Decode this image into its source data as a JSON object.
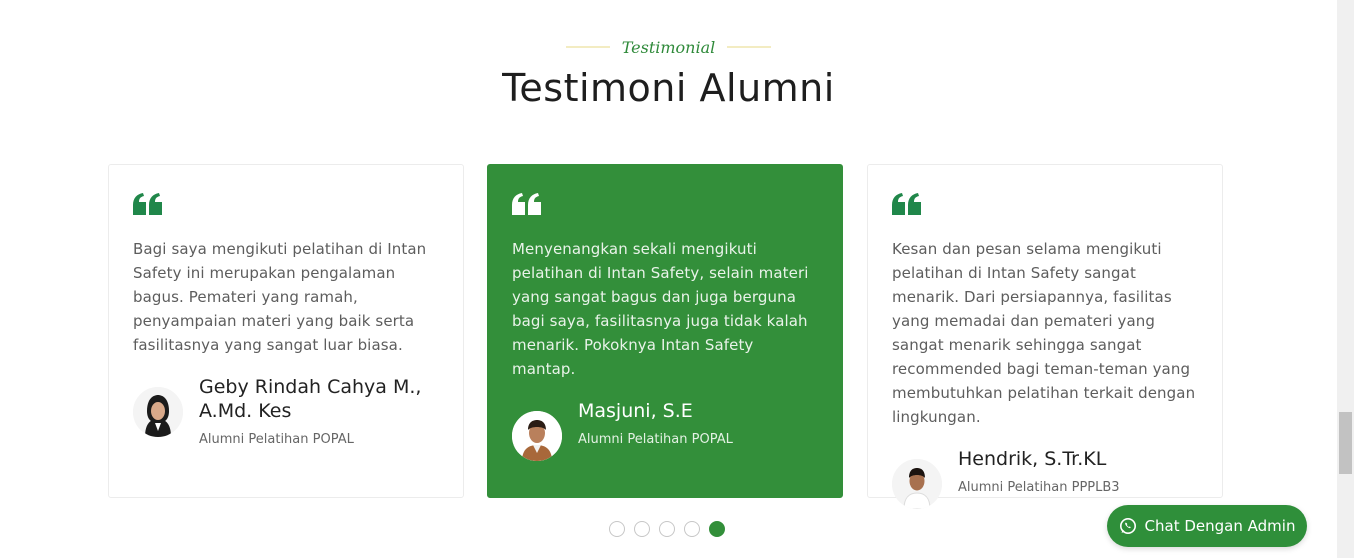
{
  "section": {
    "eyebrow": "Testimonial",
    "title": "Testimoni Alumni"
  },
  "testimonials": [
    {
      "text": "Bagi saya mengikuti pelatihan di Intan Safety ini merupakan pengalaman bagus. Pemateri yang ramah, penyampaian materi yang baik serta fasilitasnya yang sangat luar biasa.",
      "name": "Geby Rindah Cahya M., A.Md. Kes",
      "role": "Alumni Pelatihan POPAL"
    },
    {
      "text": "Menyenangkan sekali mengikuti pelatihan di Intan Safety, selain materi yang sangat bagus dan juga berguna bagi saya, fasilitasnya juga tidak kalah menarik. Pokoknya Intan Safety mantap.",
      "name": "Masjuni, S.E",
      "role": "Alumni Pelatihan POPAL"
    },
    {
      "text": "Kesan dan pesan selama mengikuti pelatihan di Intan Safety sangat menarik. Dari persiapannya, fasilitas yang memadai dan pemateri yang sangat menarik sehingga sangat recommended bagi teman-teman yang membutuhkan pelatihan terkait dengan lingkungan.",
      "name": "Hendrik, S.Tr.KL",
      "role": "Alumni Pelatihan PPPLB3"
    }
  ],
  "carousel": {
    "page_count": 5,
    "active_page": 5
  },
  "chat": {
    "label": "Chat Dengan Admin",
    "icon": "whatsapp-icon"
  },
  "colors": {
    "accent": "#338f3a",
    "quote_icon": "#20874a"
  }
}
